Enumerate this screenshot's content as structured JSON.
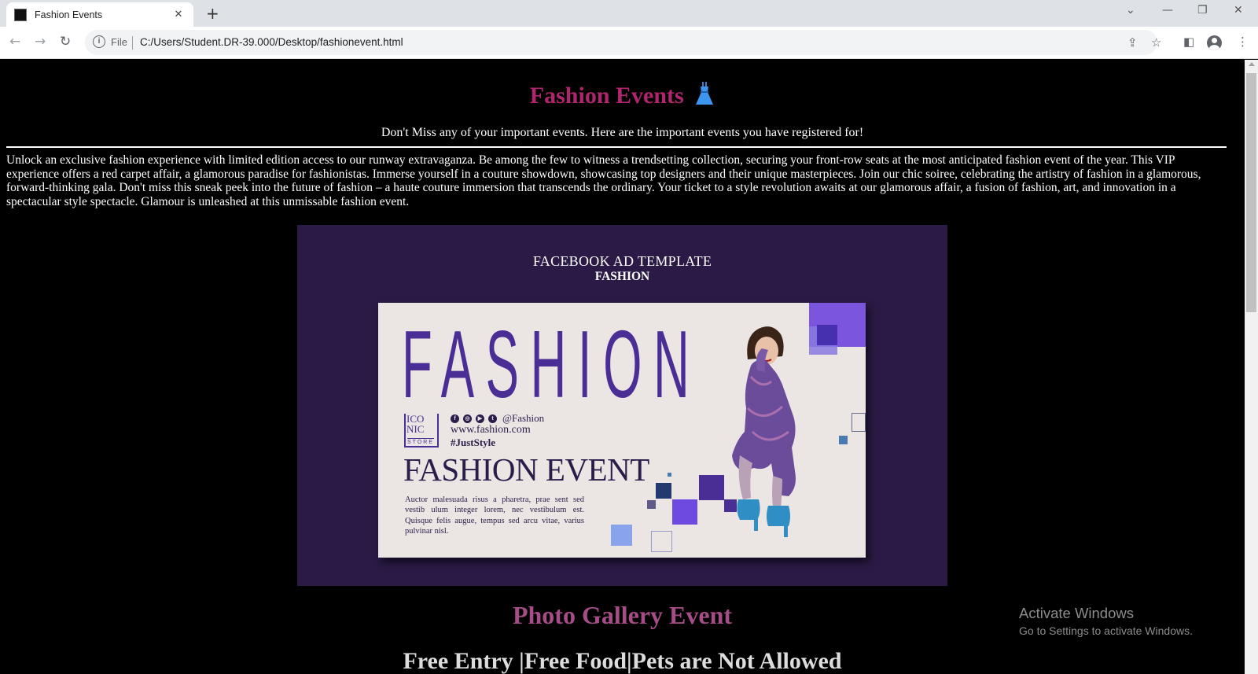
{
  "browser": {
    "tab_title": "Fashion Events",
    "tab_close": "✕",
    "new_tab": "+",
    "omnibox_scheme": "File",
    "url": "C:/Users/Student.DR-39.000/Desktop/fashionevent.html",
    "window_controls": [
      "⌄",
      "—",
      "❐",
      "✕"
    ]
  },
  "page": {
    "title": "Fashion Events",
    "subtitle": "Don't Miss any of your important events. Here are the important events you have registered for!",
    "intro": "Unlock an exclusive fashion experience with limited edition access to our runway extravaganza. Be among the few to witness a trendsetting collection, securing your front-row seats at the most anticipated fashion event of the year. This VIP experience offers a red carpet affair, a glamorous paradise for fashionistas. Immerse yourself in a couture showdown, showcasing top designers and their unique masterpieces. Join our chic soiree, celebrating the artistry of fashion in a glamorous, forward-thinking gala. Don't miss this sneak peek into the future of fashion – a haute couture immersion that transcends the ordinary. Your ticket to a style revolution awaits at our glamorous affair, a fusion of fashion, art, and innovation in a spectacular style spectacle. Glamour is unleashed at this unmissable fashion event.",
    "ad": {
      "heading": "FACEBOOK AD TEMPLATE",
      "subheading": "FASHION",
      "big_word": "FASHION",
      "logo_line1": "ICO",
      "logo_line2": "NIC",
      "logo_store": "STORE",
      "social_handle": "@Fashion",
      "social_icons": [
        "f",
        "◎",
        "▶",
        "t"
      ],
      "website": "www.fashion.com",
      "hashtag": "#JustStyle",
      "event_title": "FASHION EVENT",
      "event_body": "Auctor malesuada risus a pharetra, prae sent sed vestib ulum integer lorem, nec vestibulum est. Quisque felis augue, tempus sed arcu vitae, varius pulvinar nisl."
    },
    "gallery_title": "Photo Gallery Event",
    "next_heading": "Free Entry |Free Food|Pets are Not Allowed"
  },
  "windows_watermark": {
    "line1": "Activate Windows",
    "line2": "Go to Settings to activate Windows."
  },
  "colors": {
    "title": "#b0266e",
    "gallery_title": "#a64d87",
    "ad_frame": "#2a1a45",
    "brand_purple": "#4a2e96"
  }
}
